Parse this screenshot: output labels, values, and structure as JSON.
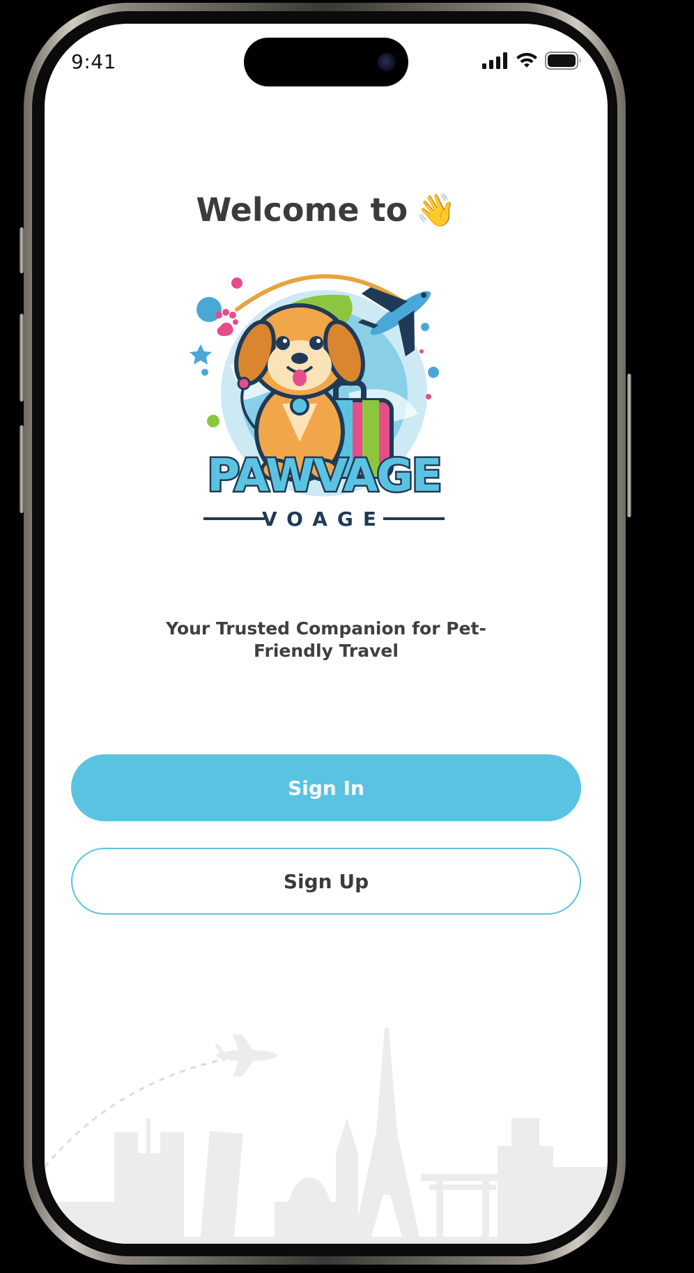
{
  "status_bar": {
    "time": "9:41",
    "icons": [
      "cellular-signal-icon",
      "wifi-icon",
      "battery-icon"
    ]
  },
  "welcome": {
    "title": "Welcome to",
    "emoji": "👋"
  },
  "logo": {
    "brand_main": "PAWVAGE",
    "brand_sub": "VOAGE"
  },
  "tagline": "Your Trusted Companion for Pet-Friendly Travel",
  "buttons": {
    "sign_in": "Sign In",
    "sign_up": "Sign Up"
  },
  "colors": {
    "accent": "#5bc3e2",
    "text_dark": "#3b3b3b",
    "background": "#ffffff"
  }
}
